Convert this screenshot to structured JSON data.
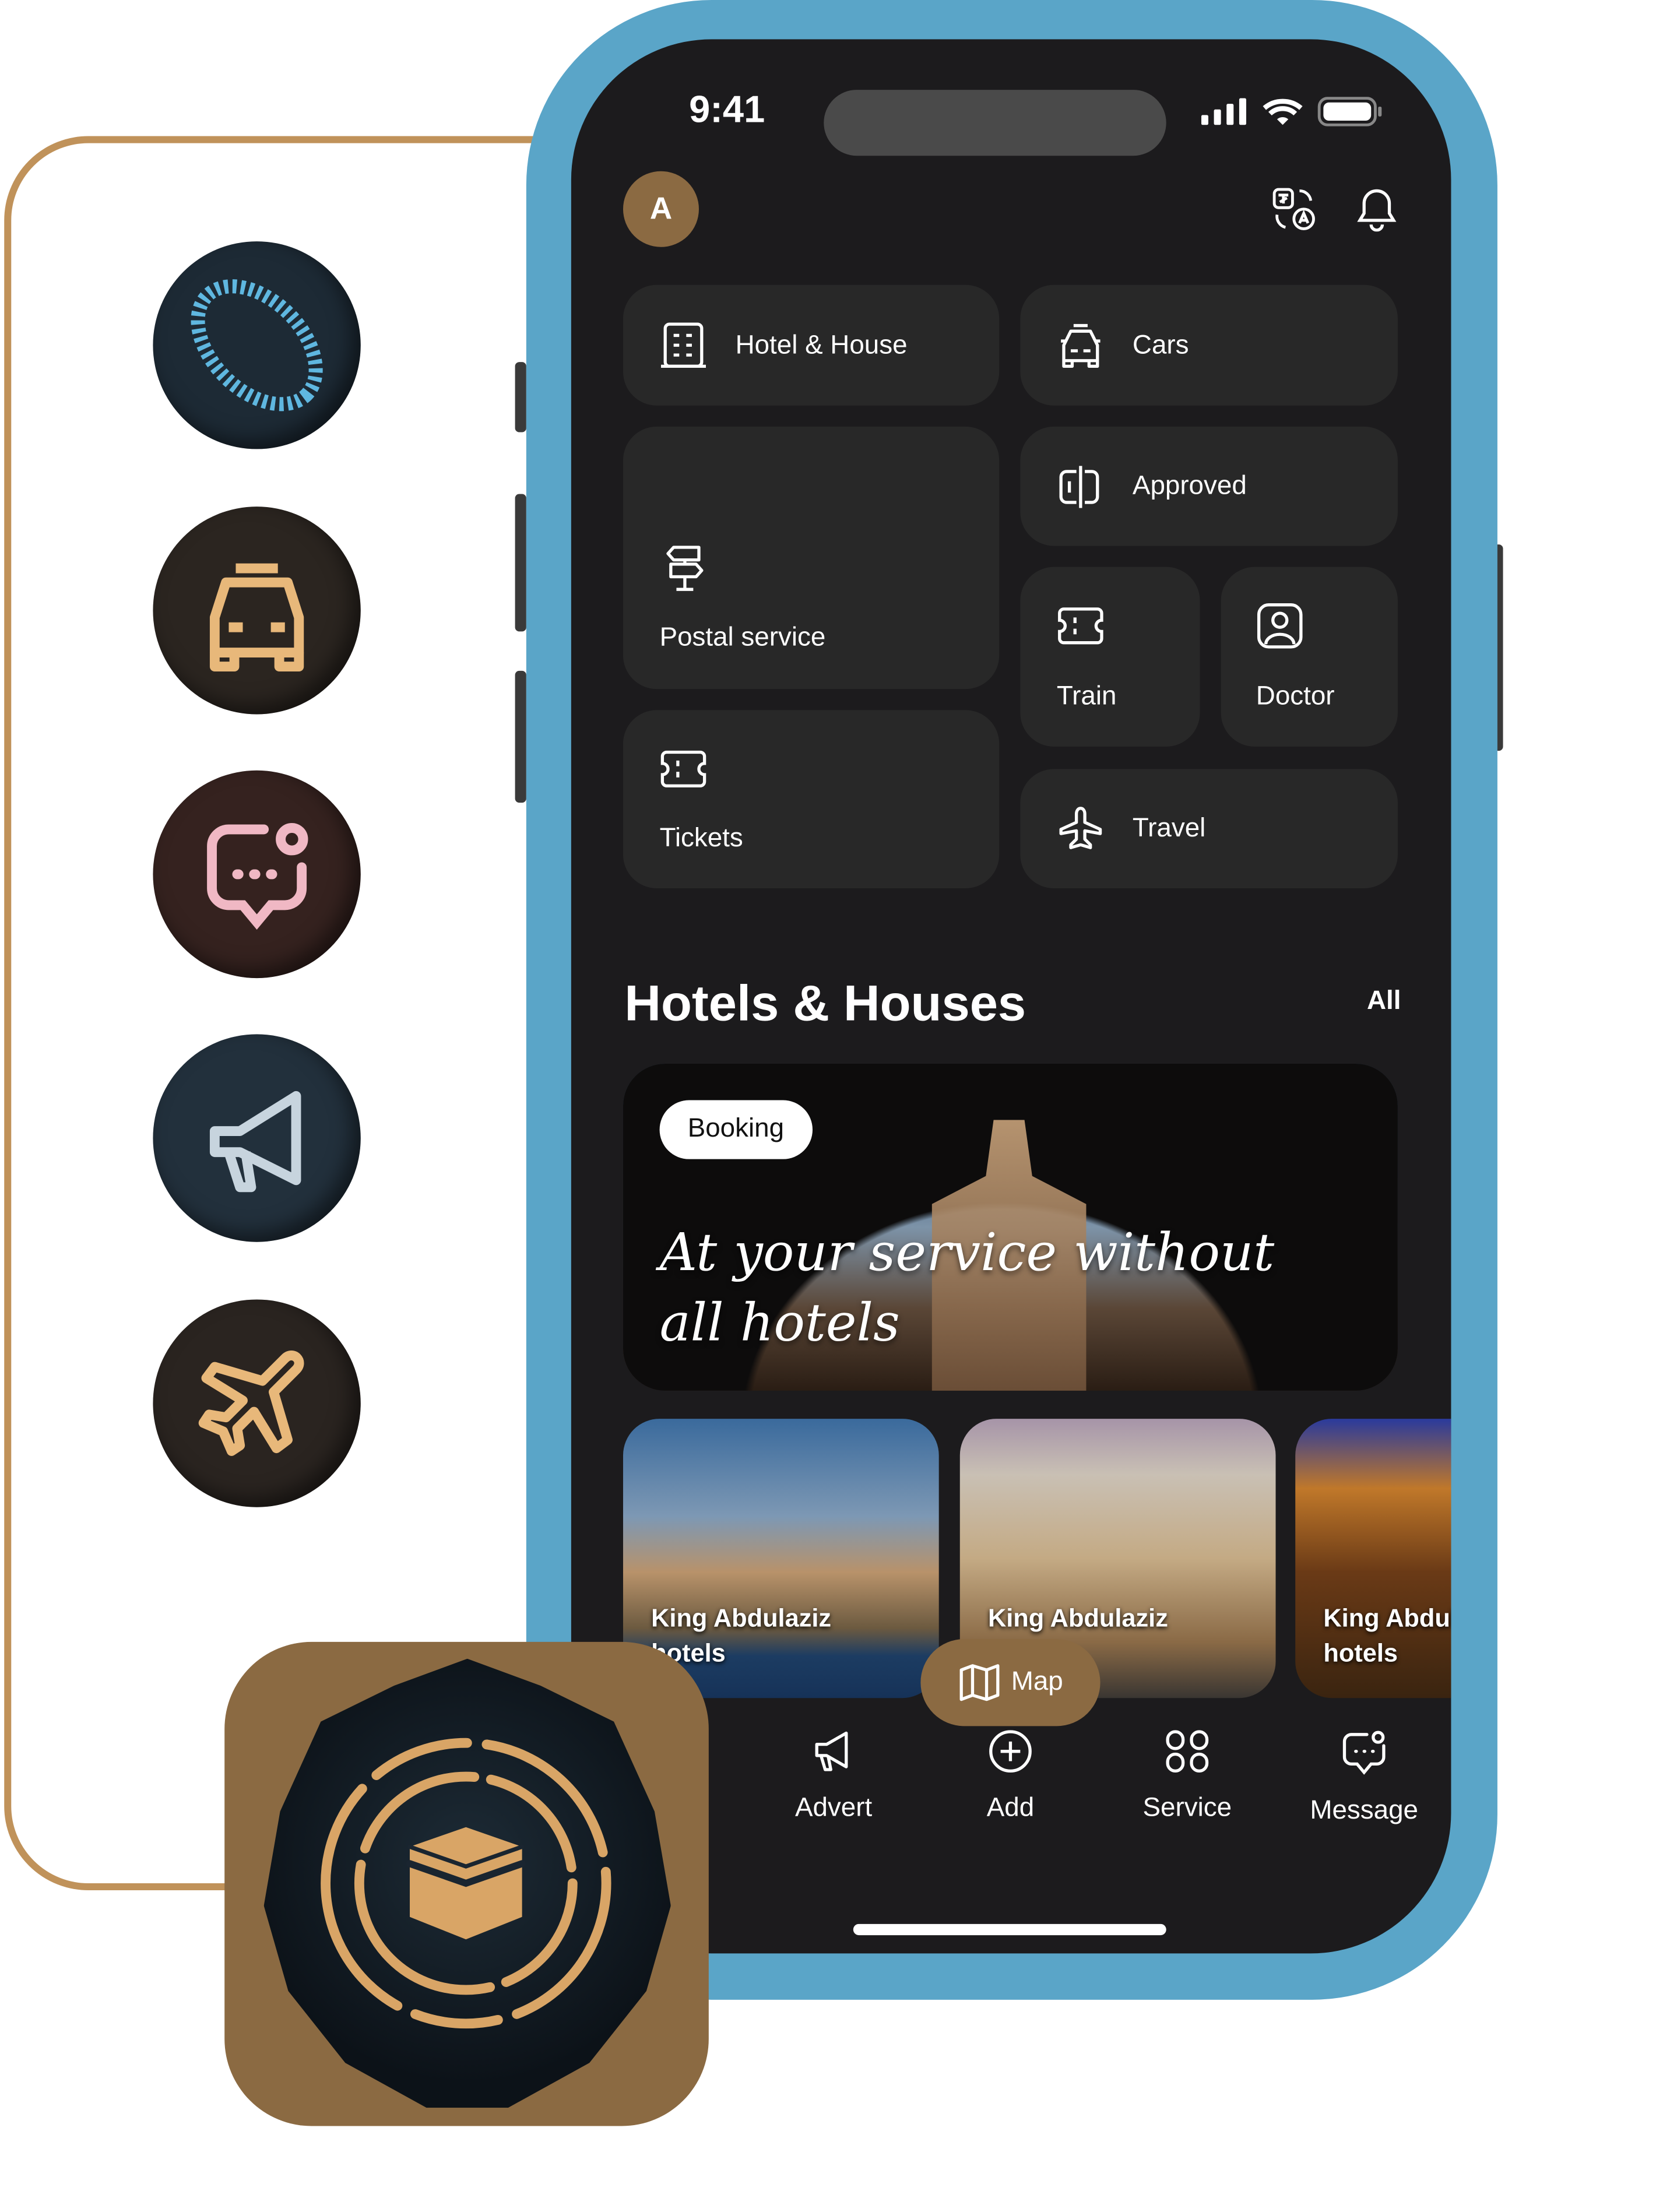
{
  "status_bar": {
    "time": "9:41",
    "icons": [
      "signal-icon",
      "wifi-icon",
      "battery-icon"
    ]
  },
  "header": {
    "avatar_letter": "A",
    "icons": [
      "translate-icon",
      "bell-icon"
    ]
  },
  "services": [
    {
      "label": "Hotel & House",
      "icon": "building-icon"
    },
    {
      "label": "Cars",
      "icon": "car-icon"
    },
    {
      "label": "Postal service",
      "icon": "signpost-icon"
    },
    {
      "label": "Approved",
      "icon": "approved-icon"
    },
    {
      "label": "Train",
      "icon": "ticket-icon"
    },
    {
      "label": "Doctor",
      "icon": "doctor-icon"
    },
    {
      "label": "Tickets",
      "icon": "ticket-icon"
    },
    {
      "label": "Travel",
      "icon": "airplane-icon"
    }
  ],
  "section": {
    "title": "Hotels & Houses",
    "all_label": "All"
  },
  "banner": {
    "badge": "Booking",
    "line1": "At your service without",
    "line2": "all hotels"
  },
  "hotels": [
    {
      "line1": "King Abdulaziz",
      "line2": "hotels"
    },
    {
      "line1": "King Abdulaziz",
      "line2": ""
    },
    {
      "line1": "King Abdulaziz",
      "line2": "hotels"
    }
  ],
  "map_button": {
    "label": "Map",
    "icon": "map-icon"
  },
  "bottom_nav": [
    {
      "label": "Advert",
      "icon": "megaphone-icon"
    },
    {
      "label": "Add",
      "icon": "plus-circle-icon"
    },
    {
      "label": "Service",
      "icon": "grid-icon"
    },
    {
      "label": "Message",
      "icon": "message-icon"
    }
  ],
  "side_icons": [
    "globe-icon",
    "car-icon",
    "chat-icon",
    "megaphone-icon",
    "airplane-icon"
  ],
  "app_icon": "kaaba-icon",
  "colors": {
    "accent": "#8b6a42",
    "outline": "#c0925a",
    "frame": "#5aa5c8",
    "screen": "#1c1b1d",
    "tile": "#282828"
  }
}
